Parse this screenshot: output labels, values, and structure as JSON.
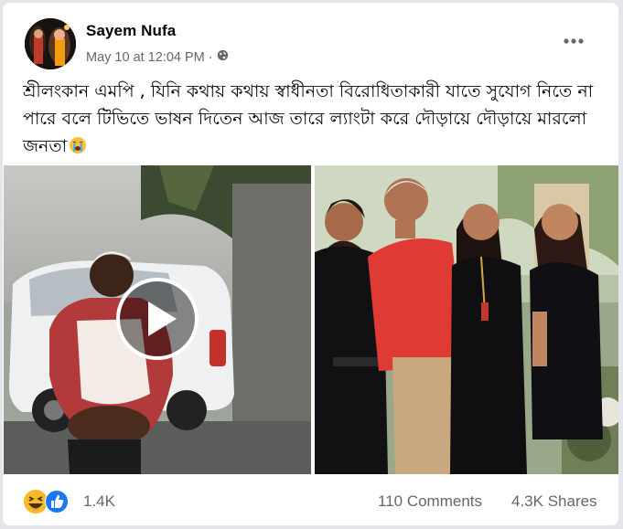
{
  "post": {
    "author": "Sayem Nufa",
    "date": "May 10 at 12:04 PM",
    "separator": "·",
    "audience_icon": "globe-icon",
    "more_icon": "more-horizontal-icon",
    "text": "শ্রীলংকান এমপি , যিনি কথায় কথায় স্বাধীনতা বিরোধিতাকারী যাতে সুযোগ নিতে না পারে বলে টিভিতে ভাষন দিতেন আজ তারে ল্যাংটা করে দৌড়ায়ে দৌড়ায়ে মারলো জনতা",
    "text_emoji": "crying-face-emoji"
  },
  "media": {
    "left_icon": "play-button-icon",
    "right_type": "photo"
  },
  "footer": {
    "reactions": [
      "haha-reaction-icon",
      "like-reaction-icon"
    ],
    "reaction_count": "1.4K",
    "comments": "110 Comments",
    "shares": "4.3K Shares"
  },
  "colors": {
    "card_bg": "#ffffff",
    "page_bg": "#e4e6eb",
    "primary_text": "#050505",
    "secondary_text": "#65676b",
    "like_blue": "#1877f2",
    "haha_yellow": "#f7b928"
  }
}
